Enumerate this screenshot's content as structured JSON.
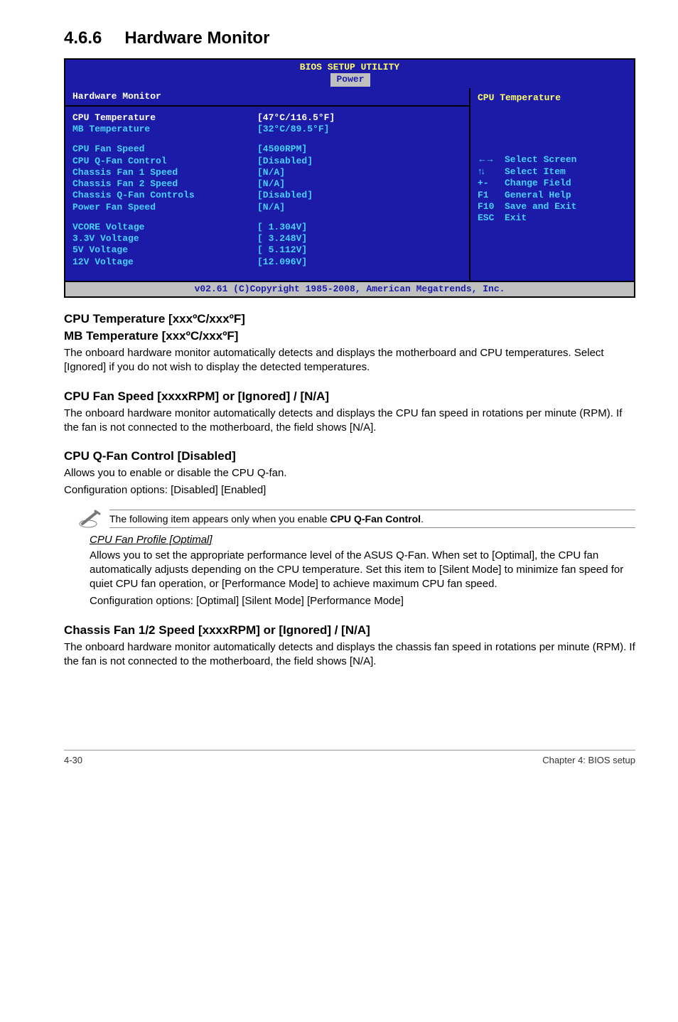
{
  "section": {
    "number": "4.6.6",
    "title": "Hardware Monitor"
  },
  "bios": {
    "title": "BIOS SETUP UTILITY",
    "tab": "Power",
    "panel_header": "Hardware Monitor",
    "right_title": "CPU Temperature",
    "rows_block1": [
      {
        "label": "CPU Temperature",
        "value": "[47°C/116.5°F]",
        "white": true
      },
      {
        "label": "MB Temperature",
        "value": "[32°C/89.5°F]"
      }
    ],
    "rows_block2": [
      {
        "label": "CPU Fan Speed",
        "value": "[4500RPM]"
      },
      {
        "label": "CPU Q-Fan Control",
        "value": "[Disabled]"
      },
      {
        "label": "Chassis Fan 1 Speed",
        "value": "[N/A]"
      },
      {
        "label": "Chassis Fan 2 Speed",
        "value": "[N/A]"
      },
      {
        "label": "Chassis Q-Fan Controls",
        "value": "[Disabled]"
      },
      {
        "label": "Power Fan Speed",
        "value": "[N/A]"
      }
    ],
    "rows_block3": [
      {
        "label": "VCORE Voltage",
        "value": "[ 1.304V]"
      },
      {
        "label": "3.3V  Voltage",
        "value": "[ 3.248V]"
      },
      {
        "label": "5V   Voltage",
        "value": "[ 5.112V]"
      },
      {
        "label": "12V  Voltage",
        "value": "[12.096V]"
      }
    ],
    "help": {
      "l1_key": "←→",
      "l1_txt": "Select Screen",
      "l2_key": "↑↓",
      "l2_txt": "Select Item",
      "l3_key": "+-",
      "l3_txt": "Change Field",
      "l4_key": "F1",
      "l4_txt": "General Help",
      "l5_key": "F10",
      "l5_txt": "Save and Exit",
      "l6_key": "ESC",
      "l6_txt": "Exit"
    },
    "footer": "v02.61 (C)Copyright 1985-2008, American Megatrends, Inc."
  },
  "h_cpu_mb_1": "CPU Temperature [xxxºC/xxxºF]",
  "h_cpu_mb_2": "MB Temperature [xxxºC/xxxºF]",
  "p_cpu_mb": "The onboard hardware monitor automatically detects and displays the motherboard and CPU temperatures. Select [Ignored] if you do not wish to display the detected temperatures.",
  "h_fanspeed": "CPU Fan Speed [xxxxRPM] or [Ignored] / [N/A]",
  "p_fanspeed": "The onboard hardware monitor automatically detects and displays the CPU fan speed in rotations per minute (RPM). If the fan is not connected to the motherboard, the field shows [N/A].",
  "h_qfan": "CPU Q-Fan Control [Disabled]",
  "p_qfan_1": "Allows you to enable or disable the CPU Q-fan.",
  "p_qfan_2": "Configuration options: [Disabled] [Enabled]",
  "note_text_pre": "The following item appears only when you enable ",
  "note_text_bold": "CPU Q-Fan Control",
  "note_text_post": ".",
  "h_profile": "CPU Fan Profile [Optimal]",
  "p_profile_1": "Allows you to set the appropriate performance level of the ASUS Q-Fan. When set to [Optimal], the CPU fan automatically adjusts depending on the CPU temperature. Set this item to [Silent Mode] to minimize fan speed for quiet CPU fan operation, or [Performance Mode] to achieve maximum CPU fan speed.",
  "p_profile_2": "Configuration options: [Optimal] [Silent Mode] [Performance Mode]",
  "h_chassis": "Chassis Fan 1/2 Speed [xxxxRPM] or [Ignored] / [N/A]",
  "p_chassis": "The onboard hardware monitor automatically detects and displays the chassis fan speed in rotations per minute (RPM). If the fan is not connected to the motherboard, the field shows [N/A].",
  "footer_left": "4-30",
  "footer_right": "Chapter 4: BIOS setup"
}
